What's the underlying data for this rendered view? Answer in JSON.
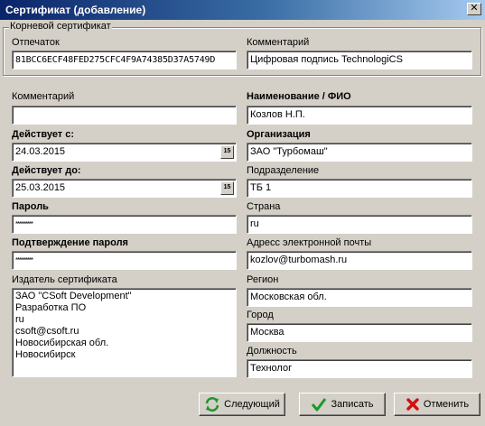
{
  "window": {
    "title": "Сертификат (добавление)"
  },
  "root_cert": {
    "group_label": "Корневой сертификат",
    "fingerprint_label": "Отпечаток",
    "fingerprint_value": "81BCC6ECF48FED275CFC4F9A74385D37A5749D",
    "comment_label": "Комментарий",
    "comment_value": "Цифровая подпись TechnologiCS"
  },
  "left": {
    "comment_label": "Комментарий",
    "comment_value": "",
    "valid_from_label": "Действует с:",
    "valid_from_value": "24.03.2015",
    "valid_to_label": "Действует до:",
    "valid_to_value": "25.03.2015",
    "calendar_glyph": "15",
    "password_label": "Пароль",
    "password_value": "*********",
    "password_confirm_label": "Подтверждение пароля",
    "password_confirm_value": "*********",
    "issuer_label": "Издатель сертификата",
    "issuer_lines": [
      "ЗАО \"CSoft Development\"",
      "Разработка ПО",
      "ru",
      "csoft@csoft.ru",
      "Новосибирская обл.",
      "Новосибирск"
    ]
  },
  "right": {
    "name_label": "Наименование / ФИО",
    "name_value": "Козлов Н.П.",
    "org_label": "Организация",
    "org_value": "ЗАО \"Турбомаш\"",
    "dept_label": "Подразделение",
    "dept_value": "ТБ 1",
    "country_label": "Страна",
    "country_value": "ru",
    "email_label": "Адресс электронной почты",
    "email_value": "kozlov@turbomash.ru",
    "region_label": "Регион",
    "region_value": "Московская обл.",
    "city_label": "Город",
    "city_value": "Москва",
    "position_label": "Должность",
    "position_value": "Технолог"
  },
  "buttons": {
    "next_label": "Следующий",
    "save_label": "Записать",
    "cancel_label": "Отменить"
  },
  "icons": {
    "next": "refresh-arrows-icon",
    "save": "checkmark-icon",
    "cancel": "red-x-icon",
    "close": "close-icon",
    "calendar": "calendar-icon"
  }
}
